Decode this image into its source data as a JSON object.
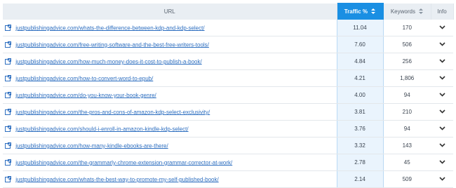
{
  "header": {
    "url_label": "URL",
    "traffic_label": "Traffic %",
    "keywords_label": "Keywords",
    "info_label": "Info"
  },
  "rows": [
    {
      "url": "justpublishingadvice.com/whats-the-difference-between-kdp-and-kdp-select/",
      "traffic": "11.04",
      "keywords": "170"
    },
    {
      "url": "justpublishingadvice.com/free-writing-software-and-the-best-free-writers-tools/",
      "traffic": "7.60",
      "keywords": "506"
    },
    {
      "url": "justpublishingadvice.com/how-much-money-does-it-cost-to-publish-a-book/",
      "traffic": "4.84",
      "keywords": "256"
    },
    {
      "url": "justpublishingadvice.com/how-to-convert-word-to-epub/",
      "traffic": "4.21",
      "keywords": "1,806"
    },
    {
      "url": "justpublishingadvice.com/do-you-know-your-book-genre/",
      "traffic": "4.00",
      "keywords": "94"
    },
    {
      "url": "justpublishingadvice.com/the-pros-and-cons-of-amazon-kdp-select-exclusivity/",
      "traffic": "3.81",
      "keywords": "210"
    },
    {
      "url": "justpublishingadvice.com/should-i-enroll-in-amazon-kindle-kdp-select/",
      "traffic": "3.76",
      "keywords": "94"
    },
    {
      "url": "justpublishingadvice.com/how-many-kindle-ebooks-are-there/",
      "traffic": "3.32",
      "keywords": "143"
    },
    {
      "url": "justpublishingadvice.com/the-grammarly-chrome-extension-grammar-corrector-at-work/",
      "traffic": "2.78",
      "keywords": "45"
    },
    {
      "url": "justpublishingadvice.com/whats-the-best-way-to-promote-my-self-published-book/",
      "traffic": "2.14",
      "keywords": "509"
    }
  ],
  "icons": {
    "external_link": "external-link-icon",
    "sort": "sort-icon",
    "expand": "chevron-down-icon"
  },
  "colors": {
    "accent": "#1a8fe3",
    "link": "#2e6fc0",
    "traffic_column_bg": "#eaf4fd",
    "header_bg": "#e9eef3"
  }
}
